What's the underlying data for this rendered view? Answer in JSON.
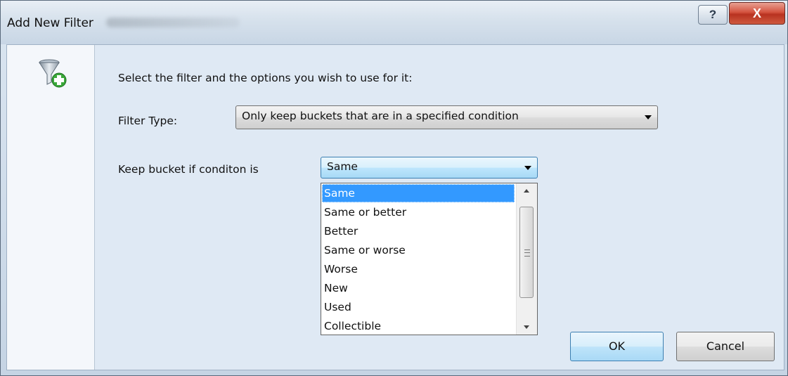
{
  "window": {
    "title": "Add New Filter",
    "help_label": "?",
    "close_label": "X"
  },
  "main": {
    "instruction": "Select the filter and the options you wish to use for it:",
    "filter_type_label": "Filter Type:",
    "filter_type_value": "Only keep buckets that are in a specified condition",
    "condition_label": "Keep bucket if conditon is",
    "condition_value": "Same"
  },
  "condition_options": [
    {
      "label": "Same",
      "selected": true
    },
    {
      "label": "Same or better"
    },
    {
      "label": "Better"
    },
    {
      "label": "Same or worse"
    },
    {
      "label": "Worse"
    },
    {
      "label": "New"
    },
    {
      "label": "Used"
    },
    {
      "label": "Collectible"
    }
  ],
  "buttons": {
    "ok": "OK",
    "cancel": "Cancel"
  },
  "colors": {
    "selection": "#3399ff",
    "close_button": "#c8432e",
    "dialog_background": "#dfe9f4"
  },
  "icons": {
    "filter": "funnel-with-plus-icon"
  }
}
